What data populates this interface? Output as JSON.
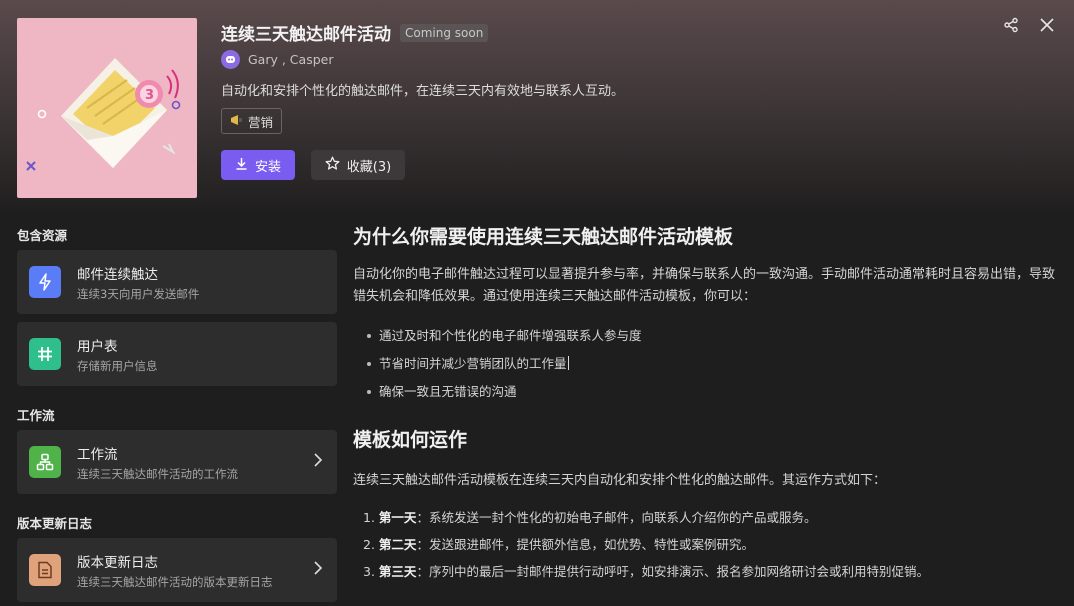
{
  "header": {
    "title": "连续三天触达邮件活动",
    "badge": "Coming soon",
    "authors": "Gary , Casper",
    "description": "自动化和安排个性化的触达邮件，在连续三天内有效地与联系人互动。",
    "tag": "营销",
    "install_label": "安装",
    "favorite_label": "收藏(3)",
    "cover_badge_number": "3"
  },
  "sidebar": {
    "resources_title": "包含资源",
    "resources": [
      {
        "title": "邮件连续触达",
        "subtitle": "连续3天向用户发送邮件",
        "icon": "bolt-icon",
        "color": "#5b7cf7"
      },
      {
        "title": "用户表",
        "subtitle": "存储新用户信息",
        "icon": "hash-icon",
        "color": "#2fbf8c"
      }
    ],
    "workflow_title": "工作流",
    "workflow": {
      "title": "工作流",
      "subtitle": "连续三天触达邮件活动的工作流",
      "icon": "workflow-icon",
      "color": "#4fb34a"
    },
    "changelog_title": "版本更新日志",
    "changelog": {
      "title": "版本更新日志",
      "subtitle": "连续三天触达邮件活动的版本更新日志",
      "icon": "document-icon",
      "color": "#e0a27a"
    }
  },
  "main": {
    "why_title": "为什么你需要使用连续三天触达邮件活动模板",
    "why_para": "自动化你的电子邮件触达过程可以显著提升参与率，并确保与联系人的一致沟通。手动邮件活动通常耗时且容易出错，导致错失机会和降低效果。通过使用连续三天触达邮件活动模板，你可以：",
    "benefits": [
      "通过及时和个性化的电子邮件增强联系人参与度",
      "节省时间并减少营销团队的工作量",
      "确保一致且无错误的沟通"
    ],
    "how_title": "模板如何运作",
    "how_para": "连续三天触达邮件活动模板在连续三天内自动化和安排个性化的触达邮件。其运作方式如下：",
    "steps": [
      {
        "num": "1.",
        "day": "第一天",
        "text": "：系统发送一封个性化的初始电子邮件，向联系人介绍你的产品或服务。"
      },
      {
        "num": "2.",
        "day": "第二天",
        "text": "：发送跟进邮件，提供额外信息，如优势、特性或案例研究。"
      },
      {
        "num": "3.",
        "day": "第三天",
        "text": "：序列中的最后一封邮件提供行动呼吁，如安排演示、报名参加网络研讨会或利用特别促销。"
      }
    ]
  }
}
